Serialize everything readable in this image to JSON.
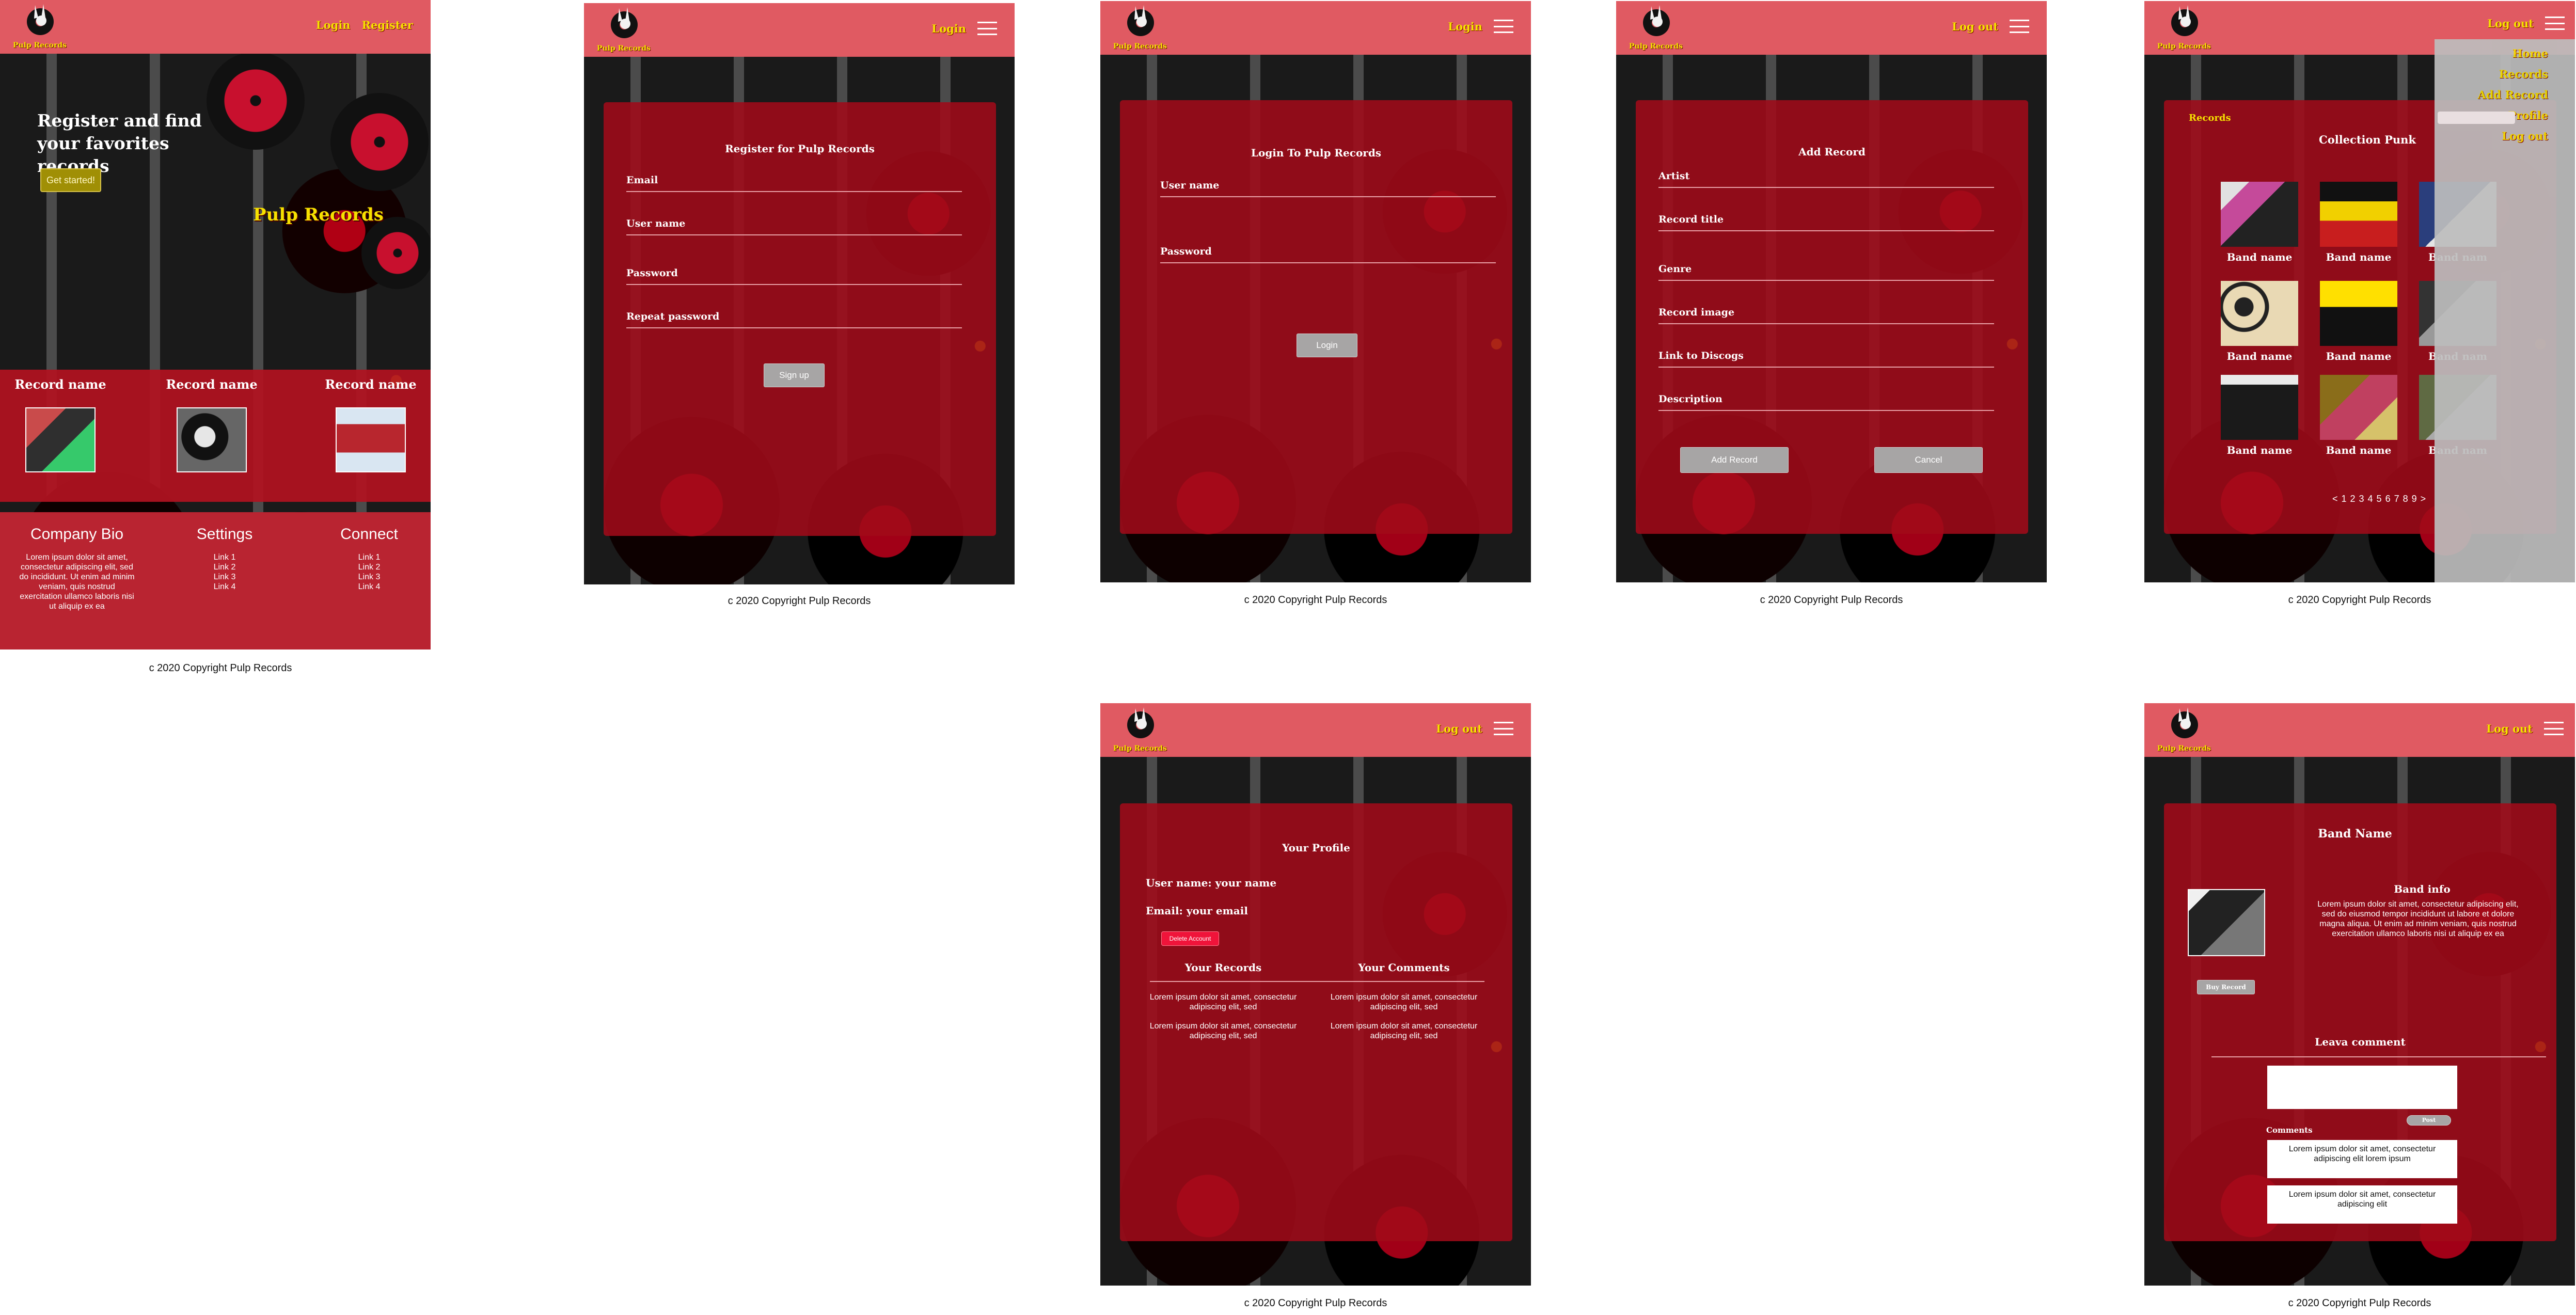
{
  "brand": {
    "logo_text": "Pulp Records",
    "colors": {
      "header": "#e05a62",
      "panel": "#a00a19",
      "accent_yellow": "#f6e100",
      "button_grey": "#a7a5a5",
      "button_gold": "#a08f05",
      "danger": "#f0143a"
    }
  },
  "copyright": "c 2020 Copyright Pulp Records",
  "home": {
    "nav": {
      "login": "Login",
      "register": "Register"
    },
    "hero_title": "Register and find your favorites records",
    "cta": "Get started!",
    "hero_brand": "Pulp Records",
    "records": [
      {
        "name": "Record name"
      },
      {
        "name": "Record name"
      },
      {
        "name": "Record name"
      }
    ],
    "footer": {
      "bio_title": "Company Bio",
      "bio_text": "Lorem ipsum dolor sit amet, consectetur adipiscing elit, sed do incididunt. Ut enim ad minim veniam, quis nostrud exercitation ullamco laboris nisi ut aliquip ex ea",
      "settings_title": "Settings",
      "settings_links": [
        "Link 1",
        "Link 2",
        "Link 3",
        "Link 4"
      ],
      "connect_title": "Connect",
      "connect_links": [
        "Link 1",
        "Link 2",
        "Link 3",
        "Link 4"
      ]
    }
  },
  "register": {
    "nav_login": "Login",
    "title": "Register for Pulp Records",
    "fields": [
      "Email",
      "User name",
      "Password",
      "Repeat password"
    ],
    "submit": "Sign up"
  },
  "login": {
    "nav_login": "Login",
    "title": "Login To Pulp Records",
    "fields": [
      "User name",
      "Password"
    ],
    "submit": "Login"
  },
  "add_record": {
    "nav_logout": "Log out",
    "title": "Add Record",
    "fields": [
      "Artist",
      "Record title",
      "Genre",
      "Record image",
      "Link to Discogs",
      "Description"
    ],
    "submit": "Add Record",
    "cancel": "Cancel"
  },
  "records": {
    "nav_logout": "Log out",
    "drawer": [
      "Home",
      "Records",
      "Add Record",
      "Profile",
      "Log out"
    ],
    "section_label": "Records",
    "collection_title": "Collection Punk",
    "items": [
      {
        "name": "Band name"
      },
      {
        "name": "Band name"
      },
      {
        "name": "Band nam"
      },
      {
        "name": "Band name"
      },
      {
        "name": "Band name"
      },
      {
        "name": "Band nam"
      },
      {
        "name": "Band name"
      },
      {
        "name": "Band name"
      },
      {
        "name": "Band nam"
      }
    ],
    "pager": "< 1 2 3 4 5 6 7 8 9 >"
  },
  "profile": {
    "nav_logout": "Log out",
    "title": "Your Profile",
    "user_line": "User name:  your name",
    "email_line": "Email: your email",
    "delete": "Delete Account",
    "records_title": "Your Records",
    "comments_title": "Your Comments",
    "entry_text": "Lorem ipsum dolor sit amet, consectetur adipiscing elit, sed"
  },
  "band": {
    "nav_logout": "Log out",
    "title": "Band Name",
    "info_title": "Band info",
    "info_text": "Lorem ipsum dolor sit amet, consectetur adipiscing elit, sed do eiusmod tempor incididunt ut labore et dolore magna aliqua. Ut enim ad minim veniam, quis nostrud exercitation ullamco laboris nisi ut aliquip ex ea",
    "buy": "Buy Record",
    "leave_comment": "Leava comment",
    "post": "Post",
    "comments_label": "Comments",
    "comments": [
      "Lorem ipsum dolor sit amet, consectetur adipiscing elit lorem ipsum",
      "Lorem ipsum dolor sit amet, consectetur adipiscing elit"
    ]
  }
}
